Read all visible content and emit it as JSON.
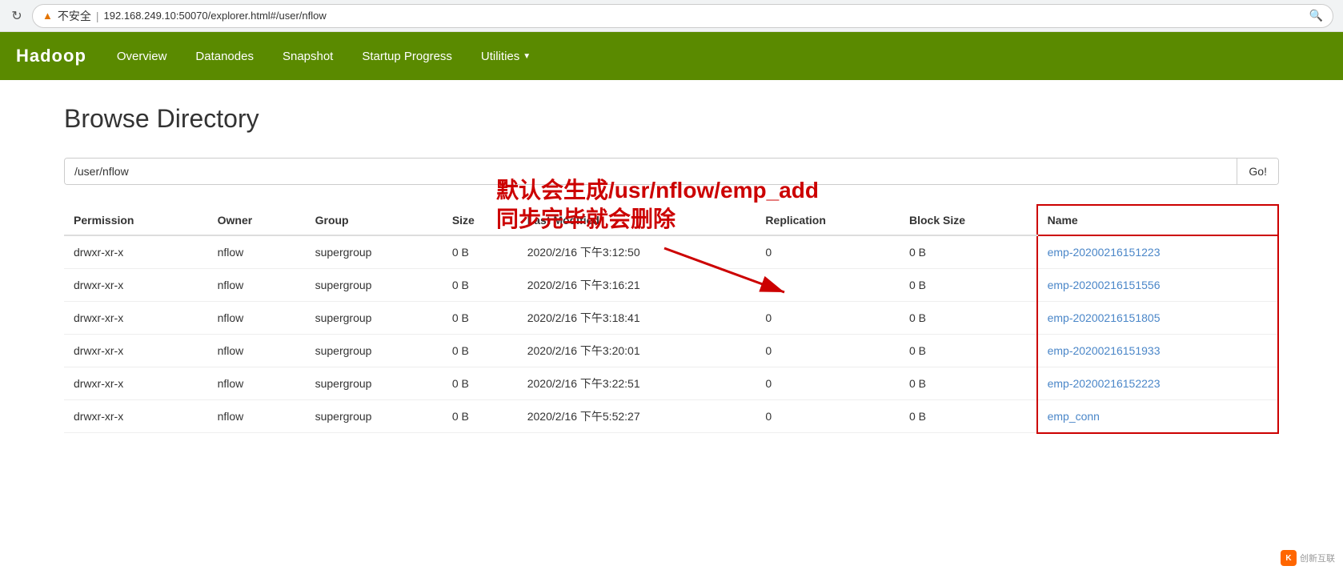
{
  "browser": {
    "url": "192.168.249.10:50070/explorer.html#/user/nflow",
    "warning_text": "不安全",
    "security_indicator": "▲"
  },
  "navbar": {
    "brand": "Hadoop",
    "items": [
      {
        "label": "Overview",
        "id": "overview"
      },
      {
        "label": "Datanodes",
        "id": "datanodes"
      },
      {
        "label": "Snapshot",
        "id": "snapshot"
      },
      {
        "label": "Startup Progress",
        "id": "startup-progress"
      },
      {
        "label": "Utilities",
        "id": "utilities",
        "dropdown": true
      }
    ]
  },
  "page": {
    "title": "Browse Directory"
  },
  "annotation": {
    "line1": "默认会生成/usr/nflow/emp_add",
    "line2": "同步完毕就会删除"
  },
  "search": {
    "value": "/user/nflow",
    "button_label": "Go!"
  },
  "table": {
    "columns": [
      {
        "key": "permission",
        "label": "Permission"
      },
      {
        "key": "owner",
        "label": "Owner"
      },
      {
        "key": "group",
        "label": "Group"
      },
      {
        "key": "size",
        "label": "Size"
      },
      {
        "key": "last_modified",
        "label": "Last Modified"
      },
      {
        "key": "replication",
        "label": "Replication"
      },
      {
        "key": "block_size",
        "label": "Block Size"
      },
      {
        "key": "name",
        "label": "Name"
      }
    ],
    "rows": [
      {
        "permission": "drwxr-xr-x",
        "owner": "nflow",
        "group": "supergroup",
        "size": "0 B",
        "last_modified": "2020/2/16 下午3:12:50",
        "replication": "0",
        "block_size": "0 B",
        "name": "emp-20200216151223",
        "is_link": true
      },
      {
        "permission": "drwxr-xr-x",
        "owner": "nflow",
        "group": "supergroup",
        "size": "0 B",
        "last_modified": "2020/2/16 下午3:16:21",
        "replication": "0",
        "block_size": "0 B",
        "name": "emp-20200216151556",
        "is_link": true
      },
      {
        "permission": "drwxr-xr-x",
        "owner": "nflow",
        "group": "supergroup",
        "size": "0 B",
        "last_modified": "2020/2/16 下午3:18:41",
        "replication": "0",
        "block_size": "0 B",
        "name": "emp-20200216151805",
        "is_link": true
      },
      {
        "permission": "drwxr-xr-x",
        "owner": "nflow",
        "group": "supergroup",
        "size": "0 B",
        "last_modified": "2020/2/16 下午3:20:01",
        "replication": "0",
        "block_size": "0 B",
        "name": "emp-20200216151933",
        "is_link": true
      },
      {
        "permission": "drwxr-xr-x",
        "owner": "nflow",
        "group": "supergroup",
        "size": "0 B",
        "last_modified": "2020/2/16 下午3:22:51",
        "replication": "0",
        "block_size": "0 B",
        "name": "emp-20200216152223",
        "is_link": true
      },
      {
        "permission": "drwxr-xr-x",
        "owner": "nflow",
        "group": "supergroup",
        "size": "0 B",
        "last_modified": "2020/2/16 下午5:52:27",
        "replication": "0",
        "block_size": "0 B",
        "name": "emp_conn",
        "is_link": true
      }
    ]
  },
  "watermark": {
    "icon_text": "K",
    "text": "创新互联"
  }
}
